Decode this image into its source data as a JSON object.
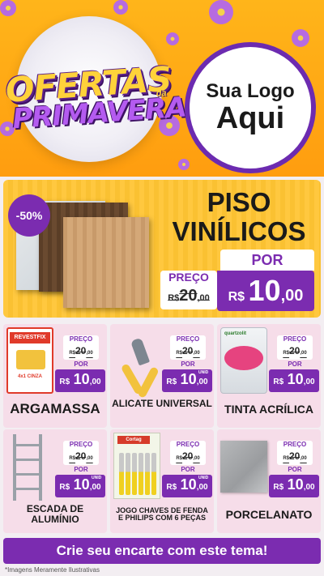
{
  "header": {
    "title_line1": "OFERTAS",
    "title_da": "da",
    "title_line2": "PRIMAVERA",
    "logo_line1": "Sua Logo",
    "logo_line2": "Aqui"
  },
  "featured": {
    "discount": "-50%",
    "name_line1": "PISO",
    "name_line2": "VINÍLICOS",
    "por_label": "POR",
    "preco_label": "PREÇO",
    "old_currency": "R$",
    "old_int": "20",
    "old_dec": ",00",
    "new_currency": "R$",
    "new_int": "10",
    "new_dec": ",00"
  },
  "products": [
    {
      "name": "ARGAMASSA",
      "icon": "mortar-bag-icon",
      "brand": "REVESTFIX",
      "brand_sub": "4x1 CINZA",
      "preco_label": "PREÇO",
      "old_cur": "R$",
      "old_int": "20",
      "old_dec": ",00",
      "por_label": "POR",
      "new_cur": "R$",
      "new_int": "10",
      "new_dec": ",00"
    },
    {
      "name": "ALICATE UNIVERSAL",
      "icon": "pliers-icon",
      "preco_label": "PREÇO",
      "old_cur": "R$",
      "old_int": "20",
      "old_dec": ",00",
      "por_label": "POR",
      "new_cur": "R$",
      "new_int": "10",
      "new_dec": ",00",
      "unit": "UNID"
    },
    {
      "name": "TINTA ACRÍLICA",
      "icon": "paint-can-icon",
      "brand": "quartzolit",
      "preco_label": "PREÇO",
      "old_cur": "R$",
      "old_int": "20",
      "old_dec": ",00",
      "por_label": "POR",
      "new_cur": "R$",
      "new_int": "10",
      "new_dec": ",00"
    },
    {
      "name": "ESCADA DE ALUMÍNIO",
      "icon": "ladder-icon",
      "preco_label": "PREÇO",
      "old_cur": "R$",
      "old_int": "20",
      "old_dec": ",00",
      "por_label": "POR",
      "new_cur": "R$",
      "new_int": "10",
      "new_dec": ",00",
      "unit": "UNID"
    },
    {
      "name": "JOGO CHAVES DE FENDA E PHILIPS COM 6 PEÇAS",
      "icon": "screwdriver-set-icon",
      "brand": "Cortag",
      "preco_label": "PREÇO",
      "old_cur": "R$",
      "old_int": "20",
      "old_dec": ",00",
      "por_label": "POR",
      "new_cur": "R$",
      "new_int": "10",
      "new_dec": ",00",
      "unit": "UNID"
    },
    {
      "name": "PORCELANATO",
      "icon": "porcelain-tile-icon",
      "preco_label": "PREÇO",
      "old_cur": "R$",
      "old_int": "20",
      "old_dec": ",00",
      "por_label": "POR",
      "new_cur": "R$",
      "new_int": "10",
      "new_dec": ",00"
    }
  ],
  "cta": {
    "label": "Crie seu encarte com este tema!"
  },
  "disclaimer": "*Imagens Meramente Ilustrativas",
  "colors": {
    "purple": "#7b2cb0",
    "orange": "#ffb51a",
    "yellow": "#ffc533",
    "card_pink": "#f6dde9"
  }
}
